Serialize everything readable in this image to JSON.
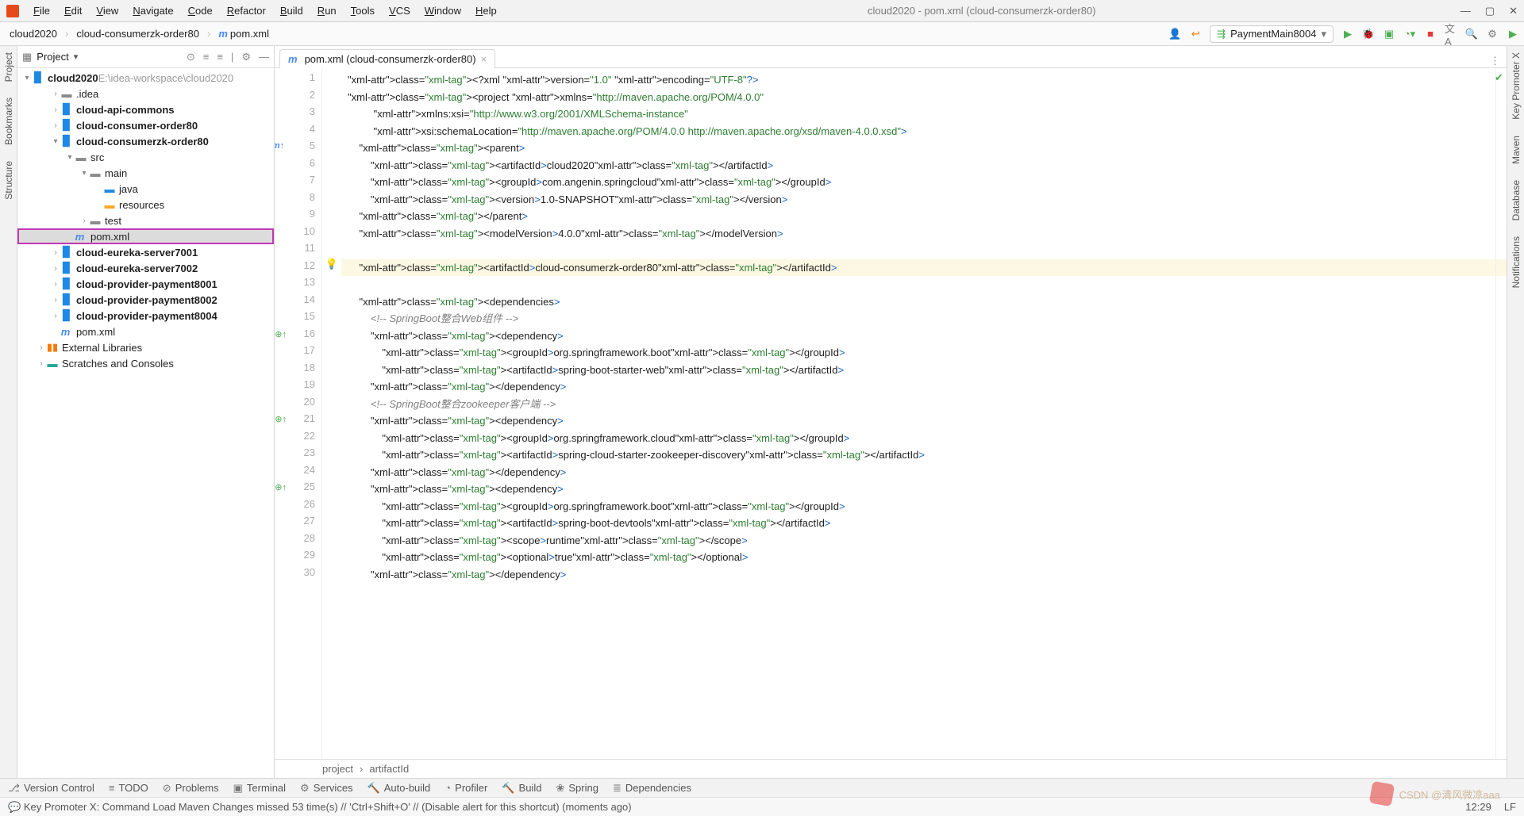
{
  "app": {
    "title": "cloud2020 - pom.xml (cloud-consumerzk-order80)"
  },
  "menu": [
    "File",
    "Edit",
    "View",
    "Navigate",
    "Code",
    "Refactor",
    "Build",
    "Run",
    "Tools",
    "VCS",
    "Window",
    "Help"
  ],
  "breadcrumb": {
    "root": "cloud2020",
    "module": "cloud-consumerzk-order80",
    "file": "pom.xml"
  },
  "run_config": "PaymentMain8004",
  "left_rail": [
    "Project",
    "Bookmarks",
    "Structure"
  ],
  "right_rail": [
    "Key Promoter X",
    "Maven",
    "Database",
    "Notifications"
  ],
  "panel": {
    "title": "Project"
  },
  "tree": {
    "root": "cloud2020",
    "root_path": "E:\\idea-workspace\\cloud2020",
    "items": [
      {
        "l": ".idea",
        "d": 1,
        "t": "dir"
      },
      {
        "l": "cloud-api-commons",
        "d": 1,
        "t": "mod",
        "b": true
      },
      {
        "l": "cloud-consumer-order80",
        "d": 1,
        "t": "mod",
        "b": true
      },
      {
        "l": "cloud-consumerzk-order80",
        "d": 1,
        "t": "mod",
        "b": true,
        "open": true
      },
      {
        "l": "src",
        "d": 2,
        "t": "dir",
        "open": true
      },
      {
        "l": "main",
        "d": 3,
        "t": "dir",
        "open": true
      },
      {
        "l": "java",
        "d": 4,
        "t": "src"
      },
      {
        "l": "resources",
        "d": 4,
        "t": "res"
      },
      {
        "l": "test",
        "d": 3,
        "t": "dir"
      },
      {
        "l": "pom.xml",
        "d": 2,
        "t": "pom",
        "sel": true,
        "hl": true
      },
      {
        "l": "cloud-eureka-server7001",
        "d": 1,
        "t": "mod",
        "b": true
      },
      {
        "l": "cloud-eureka-server7002",
        "d": 1,
        "t": "mod",
        "b": true
      },
      {
        "l": "cloud-provider-payment8001",
        "d": 1,
        "t": "mod",
        "b": true
      },
      {
        "l": "cloud-provider-payment8002",
        "d": 1,
        "t": "mod",
        "b": true
      },
      {
        "l": "cloud-provider-payment8004",
        "d": 1,
        "t": "mod",
        "b": true
      },
      {
        "l": "pom.xml",
        "d": 1,
        "t": "pom"
      },
      {
        "l": "External Libraries",
        "d": 0,
        "t": "lib"
      },
      {
        "l": "Scratches and Consoles",
        "d": 0,
        "t": "scr"
      }
    ]
  },
  "tab": {
    "label": "pom.xml (cloud-consumerzk-order80)"
  },
  "code_lines": [
    "<?xml version=\"1.0\" encoding=\"UTF-8\"?>",
    "<project xmlns=\"http://maven.apache.org/POM/4.0.0\"",
    "         xmlns:xsi=\"http://www.w3.org/2001/XMLSchema-instance\"",
    "         xsi:schemaLocation=\"http://maven.apache.org/POM/4.0.0 http://maven.apache.org/xsd/maven-4.0.0.xsd\">",
    "    <parent>",
    "        <artifactId>cloud2020</artifactId>",
    "        <groupId>com.angenin.springcloud</groupId>",
    "        <version>1.0-SNAPSHOT</version>",
    "    </parent>",
    "    <modelVersion>4.0.0</modelVersion>",
    "",
    "    <artifactId>cloud-consumerzk-order80</artifactId>",
    "",
    "    <dependencies>",
    "        <!-- SpringBoot整合Web组件 -->",
    "        <dependency>",
    "            <groupId>org.springframework.boot</groupId>",
    "            <artifactId>spring-boot-starter-web</artifactId>",
    "        </dependency>",
    "        <!-- SpringBoot整合zookeeper客户端 -->",
    "        <dependency>",
    "            <groupId>org.springframework.cloud</groupId>",
    "            <artifactId>spring-cloud-starter-zookeeper-discovery</artifactId>",
    "        </dependency>",
    "        <dependency>",
    "            <groupId>org.springframework.boot</groupId>",
    "            <artifactId>spring-boot-devtools</artifactId>",
    "            <scope>runtime</scope>",
    "            <optional>true</optional>",
    "        </dependency>"
  ],
  "highlighted_line": 12,
  "editor_breadcrumb": [
    "project",
    "artifactId"
  ],
  "bottom_tools": [
    "Version Control",
    "TODO",
    "Problems",
    "Terminal",
    "Services",
    "Auto-build",
    "Profiler",
    "Build",
    "Spring",
    "Dependencies"
  ],
  "status": {
    "msg": "Key Promoter X: Command Load Maven Changes missed 53 time(s) // 'Ctrl+Shift+O' // (Disable alert for this shortcut) (moments ago)",
    "pos": "12:29",
    "enc": "LF"
  },
  "watermark": "CSDN @清风微凉aaa"
}
